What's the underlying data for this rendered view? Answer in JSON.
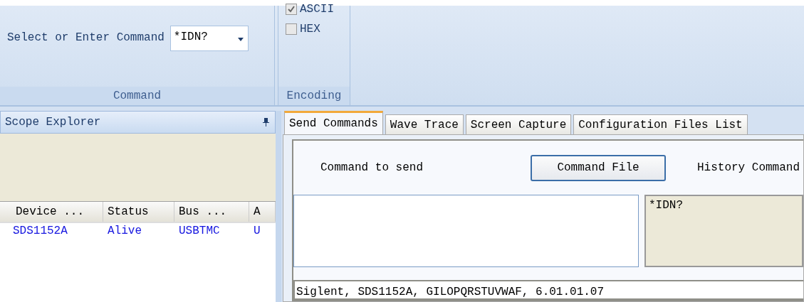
{
  "ribbon": {
    "command_group": {
      "label": "Select or Enter Command",
      "combo_value": "*IDN?",
      "title": "Command"
    },
    "encoding_group": {
      "options": [
        {
          "label": "ASCII",
          "checked": true
        },
        {
          "label": "HEX",
          "checked": false
        }
      ],
      "title": "Encoding"
    }
  },
  "explorer": {
    "title": "Scope Explorer",
    "columns": [
      "Device ...",
      "Status",
      "Bus ...",
      "A"
    ],
    "rows": [
      [
        "SDS1152A",
        "Alive",
        "USBTMC",
        "U"
      ]
    ]
  },
  "tabs": [
    {
      "label": "Send Commands",
      "selected": true
    },
    {
      "label": "Wave Trace",
      "selected": false
    },
    {
      "label": "Screen Capture",
      "selected": false
    },
    {
      "label": "Configuration Files List",
      "selected": false
    }
  ],
  "send_panel": {
    "command_label": "Command to send",
    "command_file_button": "Command File",
    "history_label": "History Command",
    "history": [
      "*IDN?"
    ],
    "response": "Siglent, SDS1152A, GILOPQRSTUVWAF, 6.01.01.07"
  }
}
